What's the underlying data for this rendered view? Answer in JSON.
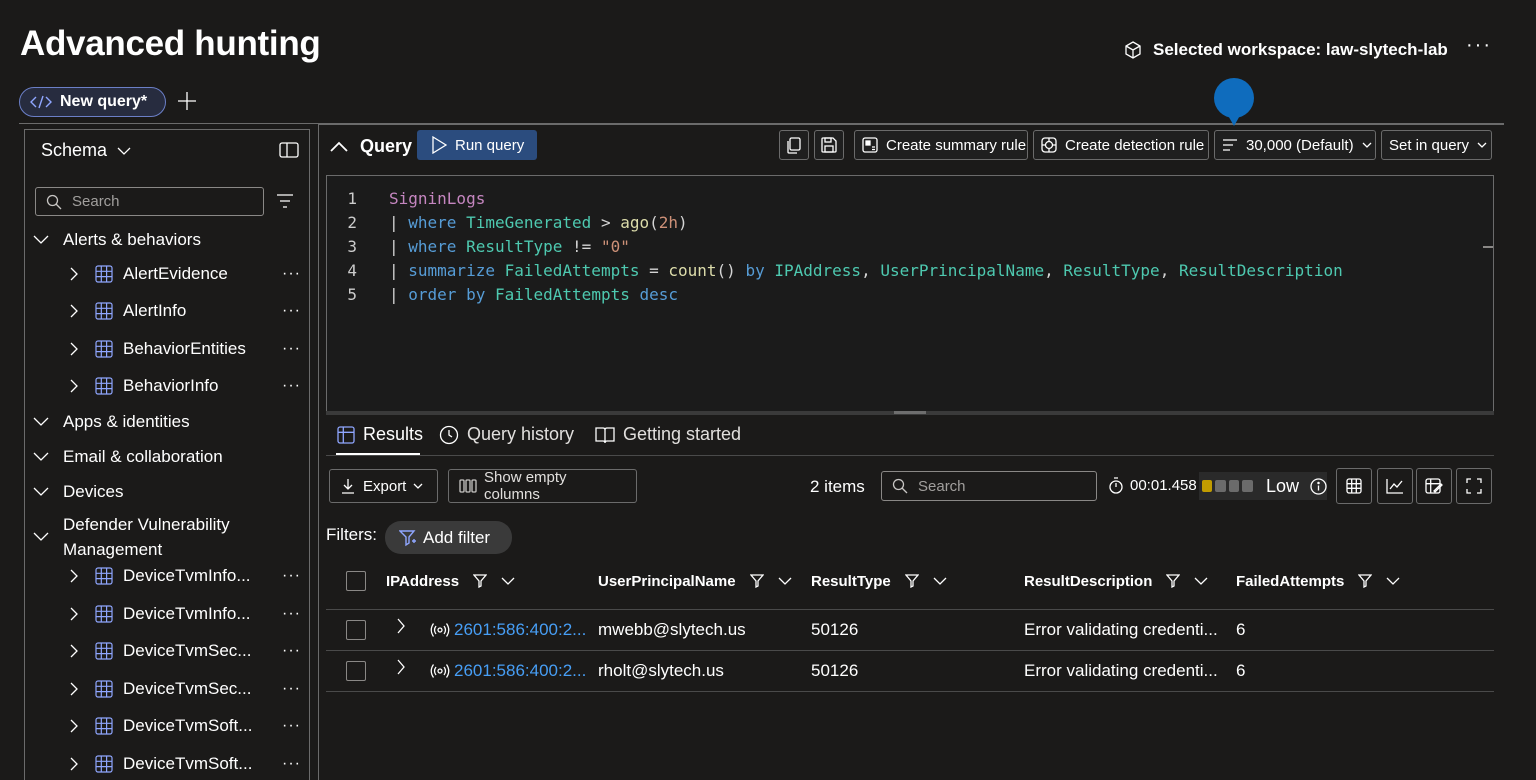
{
  "page": {
    "title": "Advanced hunting",
    "workspace_label": "Selected workspace: law-slytech-lab"
  },
  "tabs": [
    {
      "label": "New query*"
    }
  ],
  "schema": {
    "title": "Schema",
    "search_placeholder": "Search",
    "categories": [
      {
        "label": "Alerts & behaviors"
      },
      {
        "label": "Apps & identities"
      },
      {
        "label": "Email & collaboration"
      },
      {
        "label": "Devices"
      },
      {
        "label": "Defender Vulnerability Management"
      }
    ],
    "alerts_items": [
      "AlertEvidence",
      "AlertInfo",
      "BehaviorEntities",
      "BehaviorInfo"
    ],
    "tvm_items": [
      "DeviceTvmInfo...",
      "DeviceTvmInfo...",
      "DeviceTvmSec...",
      "DeviceTvmSec...",
      "DeviceTvmSoft...",
      "DeviceTvmSoft..."
    ]
  },
  "query": {
    "label": "Query",
    "run_label": "Run query",
    "create_summary_rule": "Create summary rule",
    "create_detection_rule": "Create detection rule",
    "limit": "30,000 (Default)",
    "set_in_query": "Set in query",
    "line_numbers": [
      "1",
      "2",
      "3",
      "4",
      "5"
    ],
    "code": {
      "l1": "SigninLogs",
      "pipe": "| ",
      "where": "where",
      "time_generated": "TimeGenerated",
      "gt": " > ",
      "ago": "ago",
      "ago_open": "(",
      "ago_val": "2h",
      "ago_close": ")",
      "result_type": "ResultType",
      "neq": " != ",
      "zero": "\"0\"",
      "summarize": "summarize",
      "failed_attempts": "FailedAttempts",
      "eq": " = ",
      "count": "count",
      "parens": "() ",
      "by": "by",
      "ip_address": "IPAddress",
      "comma": ", ",
      "upn": "UserPrincipalName",
      "result_description": "ResultDescription",
      "order": "order",
      "desc": "desc"
    }
  },
  "results": {
    "tabs": [
      "Results",
      "Query history",
      "Getting started"
    ],
    "export_label": "Export",
    "show_empty_columns": "Show empty columns",
    "items_count": "2 items",
    "search_placeholder": "Search",
    "elapsed": "00:01.458",
    "efficiency": "Low",
    "efficiency_level": 1,
    "filters_label": "Filters:",
    "add_filter": "Add filter",
    "columns": [
      "IPAddress",
      "UserPrincipalName",
      "ResultType",
      "ResultDescription",
      "FailedAttempts"
    ],
    "rows": [
      {
        "ip": "2601:586:400:2...",
        "upn": "mwebb@slytech.us",
        "result_type": "50126",
        "desc": "Error validating credenti...",
        "failed": "6"
      },
      {
        "ip": "2601:586:400:2...",
        "upn": "rholt@slytech.us",
        "result_type": "50126",
        "desc": "Error validating credenti...",
        "failed": "6"
      }
    ]
  },
  "colors": {
    "accent": "#0f6cbd",
    "run_button": "#2b4c7e",
    "link": "#479ef5",
    "efficiency_on": "#c19c00"
  }
}
